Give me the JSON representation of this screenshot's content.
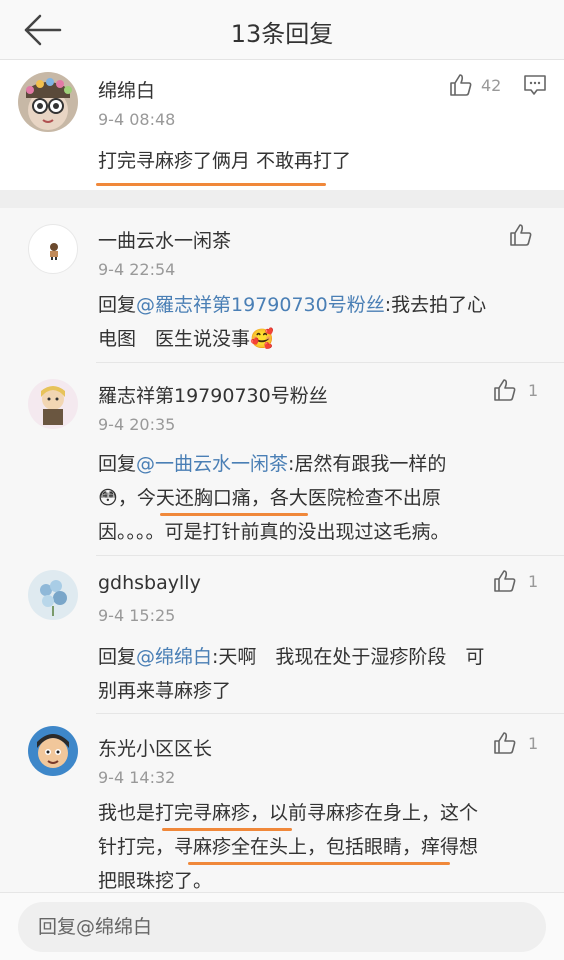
{
  "header": {
    "title": "13条回复"
  },
  "main_comment": {
    "author": "绵绵白",
    "time": "9-4 08:48",
    "text": "打完寻麻疹了俩月 不敢再打了",
    "likes": "42"
  },
  "replies": [
    {
      "author": "一曲云水一闲茶",
      "time": "9-4 22:54",
      "reply_prefix": "回复",
      "mention": "@羅志祥第19790730号粉丝",
      "text_line1": ":我去拍了心",
      "text_line2": "电图　医生说没事",
      "emoji": "🥰",
      "likes": ""
    },
    {
      "author": "羅志祥第19790730号粉丝",
      "time": "9-4 20:35",
      "reply_prefix": "回复",
      "mention": "@一曲云水一闲茶",
      "text_line1": ":居然有跟我一样的",
      "emoji": "😳",
      "text_line2": "，今天还胸口痛，各大医院检查不出原",
      "text_line3": "因。。。。可是打针前真的没出现过这毛病。",
      "likes": "1"
    },
    {
      "author": "gdhsbaylly",
      "time": "9-4 15:25",
      "reply_prefix": "回复",
      "mention": "@绵绵白",
      "text_line1": ":天啊　我现在处于湿疹阶段　可",
      "text_line2": "别再来荨麻疹了",
      "likes": "1"
    },
    {
      "author": "东光小区区长",
      "time": "9-4 14:32",
      "text_line1": "我也是打完寻麻疹，以前寻麻疹在身上，这个",
      "text_line2": "针打完，寻麻疹全在头上，包括眼睛，痒得想",
      "text_line3": "把眼珠挖了。",
      "likes": "1"
    }
  ],
  "footer": {
    "placeholder": "回复@绵绵白"
  },
  "colors": {
    "mention": "#4a7fb5",
    "underline": "#f0883a"
  }
}
